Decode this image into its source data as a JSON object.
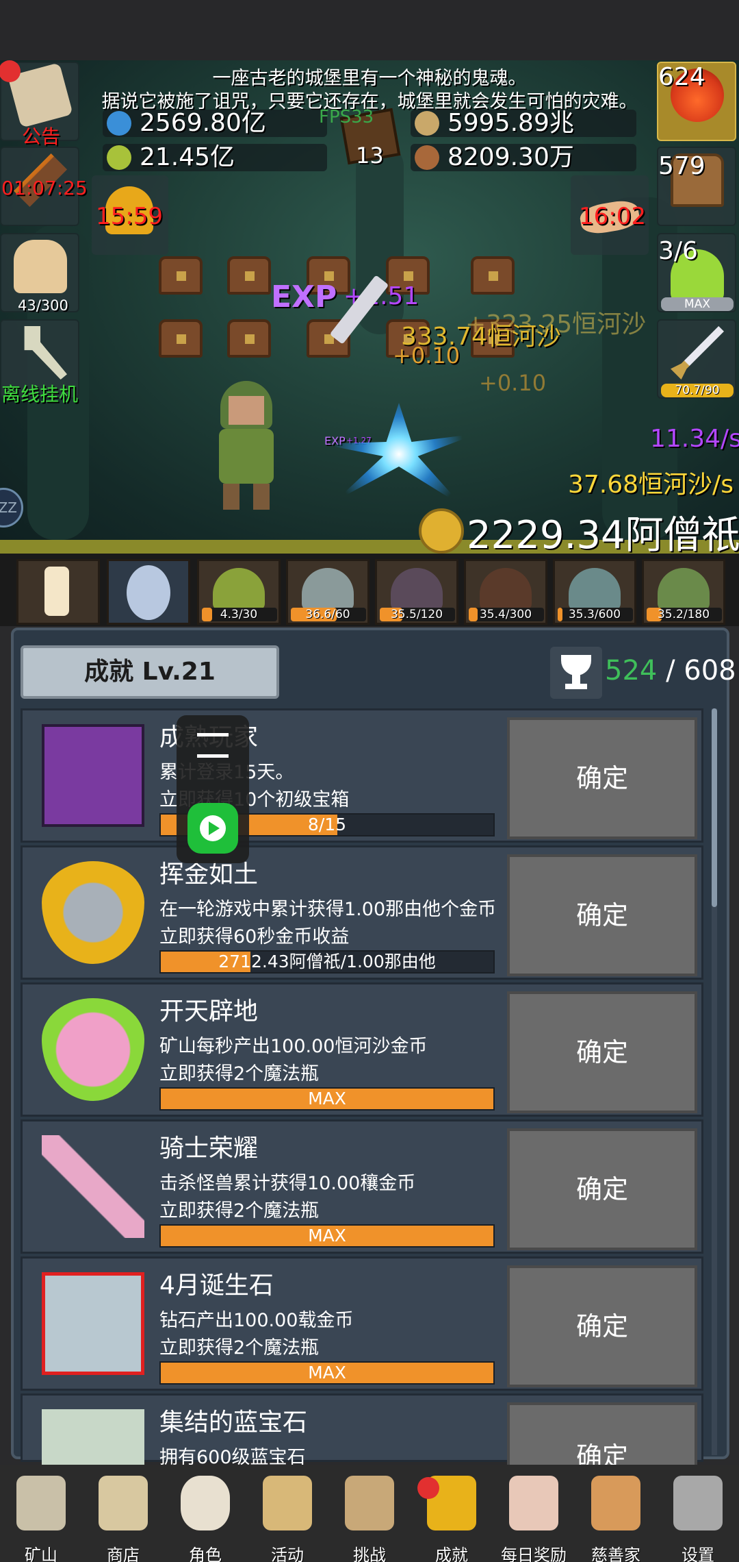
{
  "story": {
    "line1": "一座古老的城堡里有一个神秘的鬼魂。",
    "line2": "据说它被施了诅咒，只要它还存在，城堡里就会发生可怕的灾难。"
  },
  "resources": {
    "potion_amount": "2569.80亿",
    "flask_amount": "21.45亿",
    "book_count": "13",
    "fps": "FPS33",
    "coin_amount": "5995.89兆",
    "seed_amount": "8209.30万"
  },
  "left_buttons": {
    "notice_label": "公告",
    "torch_timer": "01:07:25",
    "bread_count": "43/300",
    "offline_label": "离线挂机"
  },
  "right_buttons": {
    "potion_count": "624",
    "chest_count": "579",
    "slime_count": "3/6",
    "slime_max": "MAX",
    "sword_value": "70.7/90"
  },
  "scene": {
    "left_timer": "15:59",
    "right_timer": "16:02",
    "exp_label": "EXP",
    "exp_gain": "+1.51",
    "gold_float": "+323.25恒河沙",
    "gold_float2": "333.74恒河沙",
    "plus_small1": "+0.10",
    "plus_small2": "+0.10",
    "exp_small": "EXP",
    "exp_small_val": "+1.27",
    "rate_purple": "11.34/s",
    "rate_yellow": "37.68恒河沙/s",
    "total_gold": "2229.34阿僧祇",
    "zz_label": "ZZ"
  },
  "slots": [
    {
      "label": "",
      "fill": 0
    },
    {
      "label": "",
      "fill": 0
    },
    {
      "label": "4.3/30",
      "fill": 0.14
    },
    {
      "label": "36.6/60",
      "fill": 0.61
    },
    {
      "label": "35.5/120",
      "fill": 0.3
    },
    {
      "label": "35.4/300",
      "fill": 0.12
    },
    {
      "label": "35.3/600",
      "fill": 0.06
    },
    {
      "label": "35.2/180",
      "fill": 0.2
    }
  ],
  "achievement": {
    "header": "成就 Lv.21",
    "done": "524",
    "separator": "/",
    "total": "608",
    "confirm_label": "确定",
    "rows": [
      {
        "title": "成熟玩家",
        "desc1": "累计登录15天。",
        "desc2": "立即获得10个初级宝箱",
        "progress": "8/15",
        "fill": 0.53
      },
      {
        "title": "挥金如土",
        "desc1": "在一轮游戏中累计获得1.00那由他个金币",
        "desc2": "立即获得60秒金币收益",
        "progress": "2712.43阿僧祇/1.00那由他",
        "fill": 0.27
      },
      {
        "title": "开天辟地",
        "desc1": "矿山每秒产出100.00恒河沙金币",
        "desc2": "立即获得2个魔法瓶",
        "progress": "MAX",
        "fill": 1
      },
      {
        "title": "骑士荣耀",
        "desc1": "击杀怪兽累计获得10.00穰金币",
        "desc2": "立即获得2个魔法瓶",
        "progress": "MAX",
        "fill": 1
      },
      {
        "title": "4月诞生石",
        "desc1": "钻石产出100.00载金币",
        "desc2": "立即获得2个魔法瓶",
        "progress": "MAX",
        "fill": 1
      },
      {
        "title": "集结的蓝宝石",
        "desc1": "拥有600级蓝宝石",
        "desc2": "",
        "progress": "",
        "fill": 0
      }
    ]
  },
  "nav": [
    "矿山",
    "商店",
    "角色",
    "活动",
    "挑战",
    "成就",
    "每日奖励",
    "慈善家",
    "设置"
  ],
  "colors": {
    "accent_orange": "#f0922a",
    "panel_bg": "#2c3946",
    "progress_green": "#3fbf5a",
    "timer_red": "#ff1f1f",
    "rate_purple": "#b347ff",
    "rate_yellow": "#ffd83a"
  }
}
